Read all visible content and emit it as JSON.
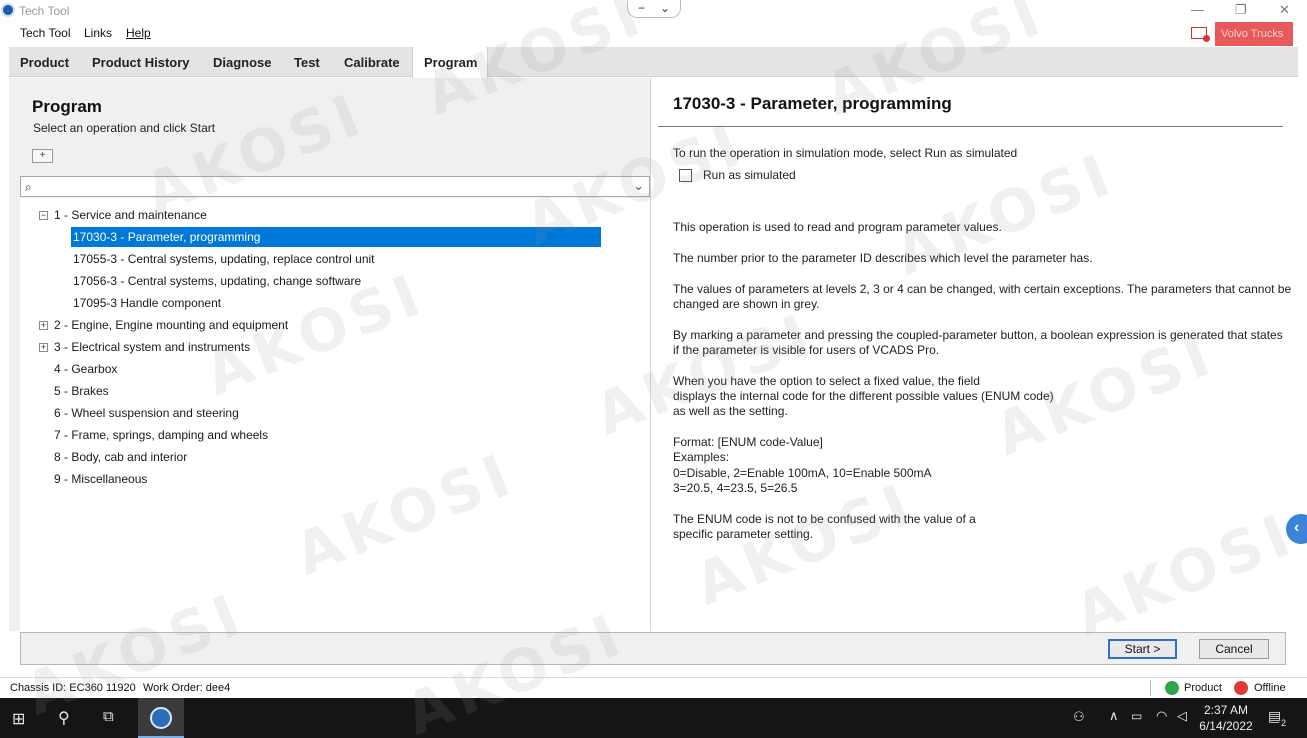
{
  "window": {
    "title": "Tech Tool"
  },
  "menu": {
    "items": [
      "Tech Tool",
      "Links",
      "Help"
    ]
  },
  "brand": {
    "label": "Volvo Trucks"
  },
  "tabs": [
    "Product",
    "Product History",
    "Diagnose",
    "Test",
    "Calibrate",
    "Program"
  ],
  "active_tab": "Program",
  "left": {
    "title": "Program",
    "subtitle": "Select an operation and click Start",
    "search_value": "",
    "tree": [
      {
        "label": "1 - Service and maintenance",
        "toggle": "−"
      },
      {
        "label": "17030-3 - Parameter, programming"
      },
      {
        "label": "17055-3 - Central systems, updating, replace control unit"
      },
      {
        "label": "17056-3 - Central systems, updating, change software"
      },
      {
        "label": "17095-3 Handle component"
      },
      {
        "label": "2 - Engine, Engine mounting and equipment",
        "toggle": "+"
      },
      {
        "label": "3 - Electrical system and instruments",
        "toggle": "+"
      },
      {
        "label": "4 - Gearbox"
      },
      {
        "label": "5 - Brakes"
      },
      {
        "label": "6 - Wheel suspension and steering"
      },
      {
        "label": "7 - Frame, springs, damping and wheels"
      },
      {
        "label": "8 - Body, cab and interior"
      },
      {
        "label": "9 - Miscellaneous"
      }
    ]
  },
  "right": {
    "title": "17030-3 - Parameter, programming",
    "sim_hint": "To run the operation in simulation mode, select Run as simulated",
    "run_simulated_label": "Run as simulated",
    "run_simulated_checked": false,
    "p1": "This operation is used to read and program parameter values.",
    "p2": "The number prior to the parameter ID describes which level the parameter has.",
    "p3a": "The values of parameters at levels 2, 3 or 4 can be changed, with certain exceptions. The parameters that cannot be",
    "p3b": "changed are shown in grey.",
    "p4a": "By marking a parameter and pressing the coupled-parameter button, a boolean expression is generated that states",
    "p4b": "if the parameter is visible for users of VCADS Pro.",
    "p5a": "When you have the option to select a fixed value, the field",
    "p5b": "displays the internal code for the different possible values (ENUM code)",
    "p5c": "as well as the setting.",
    "p6a": "Format: [ENUM code-Value]",
    "p6b": "Examples:",
    "p6c": "0=Disable, 2=Enable 100mA, 10=Enable 500mA",
    "p6d": "3=20.5, 4=23.5, 5=26.5",
    "p7a": "The ENUM code is not to be confused with the value of a",
    "p7b": "specific parameter setting."
  },
  "buttons": {
    "start": "Start >",
    "cancel": "Cancel"
  },
  "status": {
    "chassis": "Chassis ID: EC360 11920",
    "work_order": "Work Order: dee4",
    "product": "Product",
    "offline": "Offline"
  },
  "taskbar": {
    "time": "2:37 AM",
    "date": "6/14/2022",
    "notification_count": "2"
  },
  "watermark": "AKOSI"
}
